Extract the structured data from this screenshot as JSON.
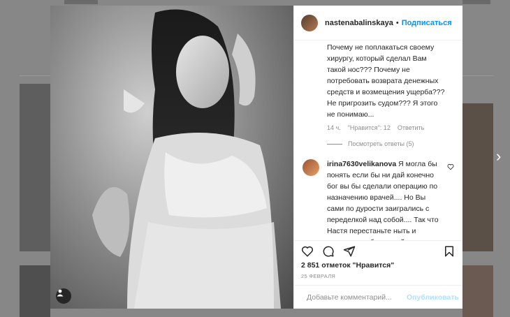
{
  "post": {
    "username": "nastenabalinskaya",
    "separator": "•",
    "follow_label": "Подписаться"
  },
  "comments": [
    {
      "text": "Почему не поплакаться своему хирургу, который сделал Вам такой нос??? Почему не потребовать возврата денежных средств и возмещения ущерба??? Не пригрозить судом??? Я этого не понимаю...",
      "time": "14 ч.",
      "likes": "\"Нравится\": 12",
      "reply": "Ответить",
      "view_replies": "Посмотреть ответы (5)"
    },
    {
      "username": "irina7630velikanova",
      "text": " Я могла бы понять если бы ни дай конечно бог вы бы сделали операцию по назначению врачей.... Но Вы сами по дурости заигрались с переделкой над собой.... Так что Настя перестаньте ныть и ищите способ и решайте свои"
    }
  ],
  "likes_count": "2 851 отметок \"Нравится\"",
  "date": "25 ФЕВРАЛЯ",
  "add_comment": {
    "placeholder": "Добавьте комментарий...",
    "publish_label": "Опубликовать"
  },
  "icons": {
    "heart": "heart-icon",
    "comment": "comment-icon",
    "share": "share-icon",
    "save": "bookmark-icon",
    "emoji": "emoji-icon",
    "tag": "user-tag-icon",
    "next": "chevron-right-icon"
  },
  "colors": {
    "accent": "#0095f6",
    "publish_disabled": "#b2dffc",
    "text": "#262626",
    "muted": "#8e8e8e"
  }
}
